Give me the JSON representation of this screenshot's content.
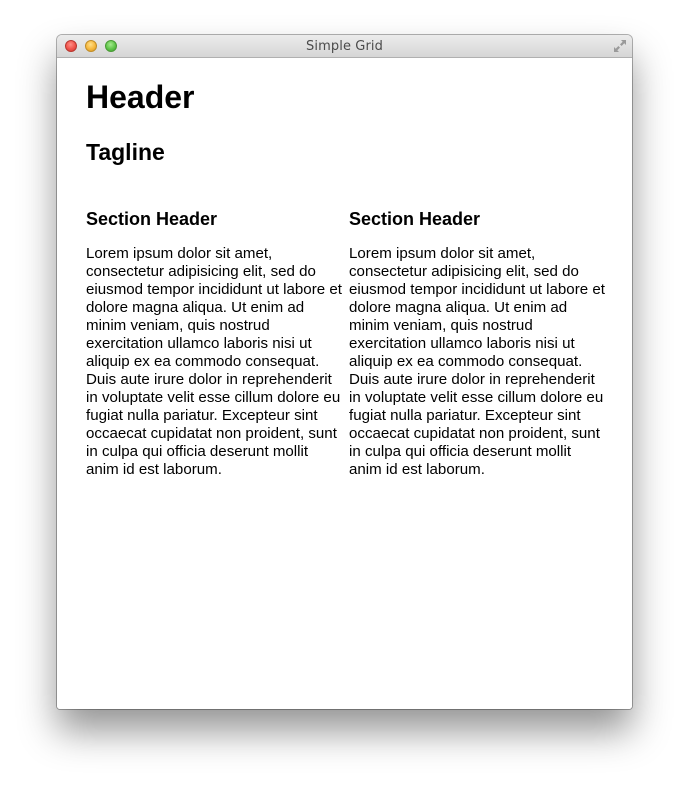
{
  "window": {
    "title": "Simple Grid"
  },
  "page": {
    "header": "Header",
    "tagline": "Tagline"
  },
  "sections": [
    {
      "header": "Section Header",
      "body": "Lorem ipsum dolor sit amet, consectetur adipisicing elit, sed do eiusmod tempor incididunt ut labore et dolore magna aliqua. Ut enim ad minim veniam, quis nostrud exercitation ullamco laboris nisi ut aliquip ex ea commodo consequat. Duis aute irure dolor in reprehenderit in voluptate velit esse cillum dolore eu fugiat nulla pariatur. Excepteur sint occaecat cupidatat non proident, sunt in culpa qui officia deserunt mollit anim id est laborum."
    },
    {
      "header": "Section Header",
      "body": "Lorem ipsum dolor sit amet, consectetur adipisicing elit, sed do eiusmod tempor incididunt ut labore et dolore magna aliqua. Ut enim ad minim veniam, quis nostrud exercitation ullamco laboris nisi ut aliquip ex ea commodo consequat. Duis aute irure dolor in reprehenderit in voluptate velit esse cillum dolore eu fugiat nulla pariatur. Excepteur sint occaecat cupidatat non proident, sunt in culpa qui officia deserunt mollit anim id est laborum."
    }
  ],
  "icons": {
    "close": "close-icon",
    "minimize": "minimize-icon",
    "zoom": "zoom-icon",
    "fullscreen": "fullscreen-icon"
  },
  "colors": {
    "close": "#f0524a",
    "minimize": "#f6b73c",
    "zoom": "#5fc549",
    "text": "#000000",
    "background": "#ffffff"
  }
}
